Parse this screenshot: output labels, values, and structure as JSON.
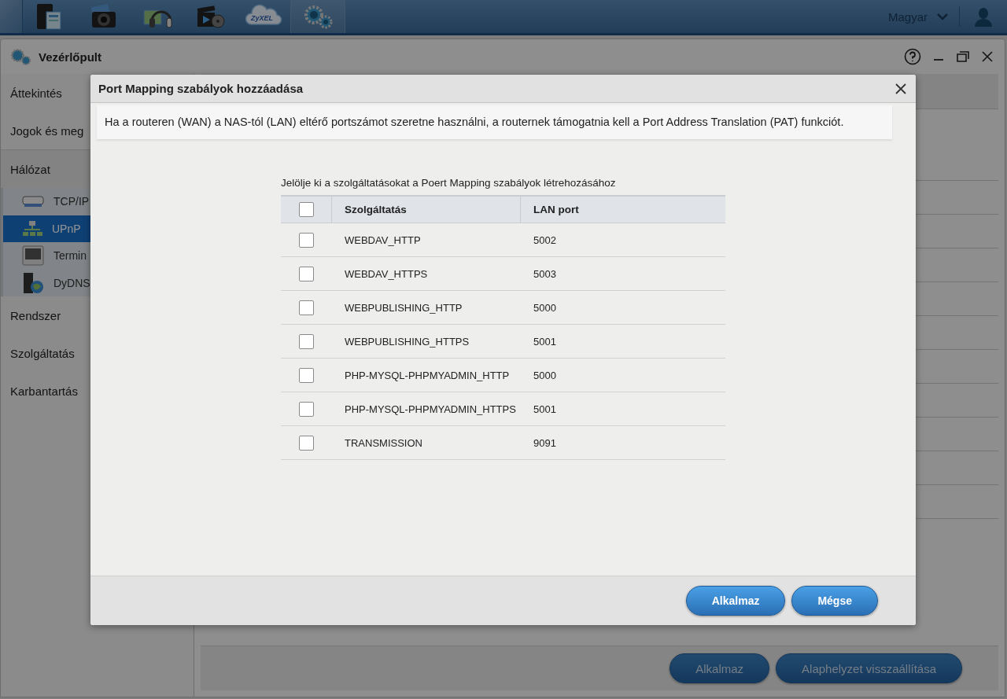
{
  "top_bar": {
    "apps": [
      {
        "kind": "files",
        "selected": false
      },
      {
        "kind": "photo",
        "selected": false
      },
      {
        "kind": "music",
        "selected": false
      },
      {
        "kind": "video",
        "selected": false
      },
      {
        "kind": "cloud",
        "selected": false
      },
      {
        "kind": "settings",
        "selected": true
      }
    ],
    "cloud_logo": "ZyXEL",
    "language": "Magyar"
  },
  "window": {
    "title": "Vezérlőpult",
    "sidebar": [
      {
        "label": "Áttekintés",
        "expanded": false
      },
      {
        "label": "Jogok és meg",
        "expanded": false
      },
      {
        "label": "Hálózat",
        "expanded": true,
        "children": [
          {
            "label": "TCP/IP",
            "kind": "router",
            "selected": false
          },
          {
            "label": "UPnP",
            "kind": "network",
            "selected": true
          },
          {
            "label": "Termin",
            "kind": "terminal",
            "selected": false
          },
          {
            "label": "DyDNS",
            "kind": "dns",
            "selected": false
          }
        ]
      },
      {
        "label": "Rendszer",
        "expanded": false
      },
      {
        "label": "Szolgáltatás",
        "expanded": false
      },
      {
        "label": "Karbantartás",
        "expanded": false
      }
    ],
    "buttons": [
      "Alkalmaz",
      "Alaphelyzet visszaállítása"
    ]
  },
  "dialog": {
    "title": "Port Mapping szabályok hozzáadása",
    "info": "Ha a routeren (WAN) a NAS-tól (LAN) eltérő portszámot szeretne használni, a routernek támogatnia kell a Port Address Translation (PAT) funkciót.",
    "instruction": "Jelölje ki a szolgáltatásokat a Poert Mapping szabályok létrehozásához",
    "table": {
      "select_all": false,
      "columns": [
        "Szolgáltatás",
        "LAN port"
      ],
      "rows": [
        {
          "service": "WEBDAV_HTTP",
          "port": "5002",
          "checked": false
        },
        {
          "service": "WEBDAV_HTTPS",
          "port": "5003",
          "checked": false
        },
        {
          "service": "WEBPUBLISHING_HTTP",
          "port": "5000",
          "checked": false
        },
        {
          "service": "WEBPUBLISHING_HTTPS",
          "port": "5001",
          "checked": false
        },
        {
          "service": "PHP-MYSQL-PHPMYADMIN_HTTP",
          "port": "5000",
          "checked": false
        },
        {
          "service": "PHP-MYSQL-PHPMYADMIN_HTTPS",
          "port": "5001",
          "checked": false
        },
        {
          "service": "TRANSMISSION",
          "port": "9091",
          "checked": false
        }
      ]
    },
    "buttons": [
      "Alkalmaz",
      "Mégse"
    ]
  }
}
